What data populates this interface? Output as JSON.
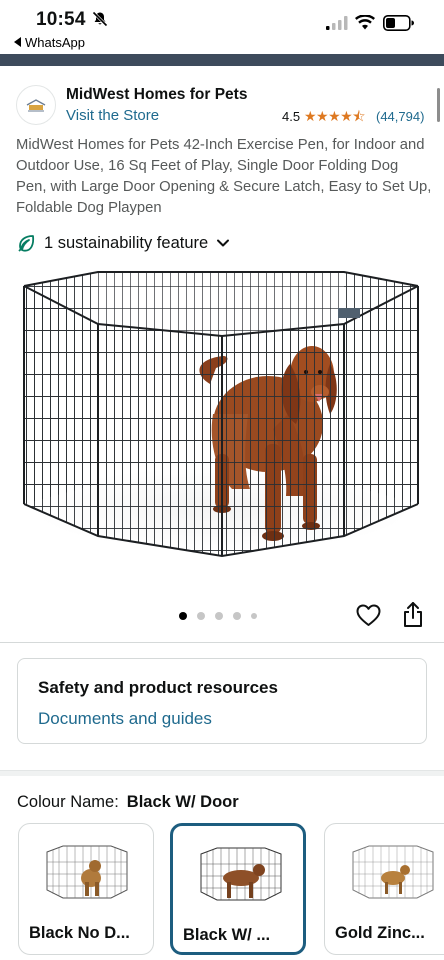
{
  "status_bar": {
    "time": "10:54",
    "back_app": "WhatsApp"
  },
  "brand": {
    "name": "MidWest Homes for Pets",
    "visit_store": "Visit the Store",
    "rating": "4.5",
    "rating_count": "(44,794)",
    "stars": "★★★★⯪"
  },
  "product": {
    "title": "MidWest Homes for Pets 42-Inch Exercise Pen, for Indoor and Outdoor Use, 16 Sq Feet of Play, Single Door Folding Dog Pen, with Large Door Opening & Secure Latch, Easy to Set Up, Foldable Dog Playpen",
    "sustainability": "1 sustainability feature"
  },
  "gallery": {
    "image_count": 5,
    "active_index": 0
  },
  "resources": {
    "title": "Safety and product resources",
    "link": "Documents and guides"
  },
  "colour": {
    "key": "Colour Name:",
    "value": "Black W/ Door",
    "options": [
      {
        "label": "Black No D..."
      },
      {
        "label": "Black W/ ..."
      },
      {
        "label": "Gold Zinc..."
      }
    ],
    "selected_index": 1
  },
  "colors": {
    "link": "#1f6a8e",
    "star": "#de7921",
    "selected_border": "#1d5d7f",
    "leaf": "#067d62"
  }
}
